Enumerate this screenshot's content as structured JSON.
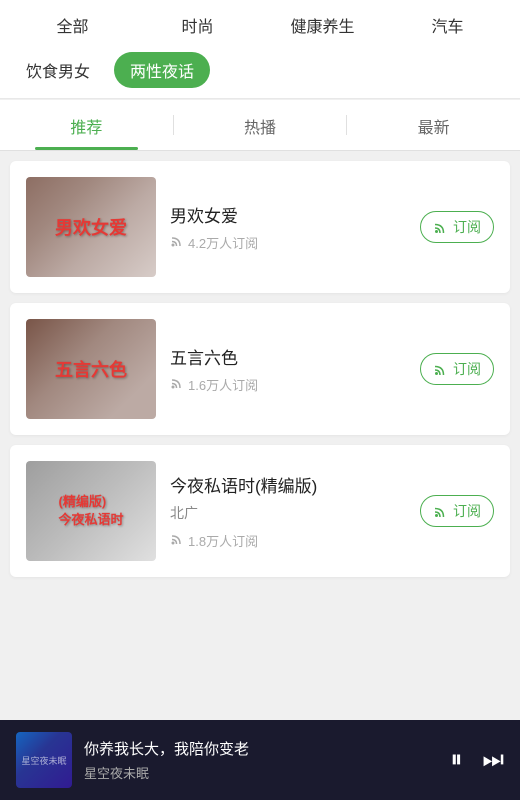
{
  "nav": {
    "row1": [
      {
        "label": "全部",
        "active": false
      },
      {
        "label": "时尚",
        "active": false
      },
      {
        "label": "健康养生",
        "active": false
      },
      {
        "label": "汽车",
        "active": false
      }
    ],
    "row2": [
      {
        "label": "饮食男女",
        "active": false
      },
      {
        "label": "两性夜话",
        "active": true
      }
    ]
  },
  "tabs": [
    {
      "label": "推荐",
      "active": true
    },
    {
      "label": "热播",
      "active": false
    },
    {
      "label": "最新",
      "active": false
    }
  ],
  "cards": [
    {
      "id": "card1",
      "title": "男欢女爱",
      "subtitle": "",
      "meta": "4.2万人订阅",
      "thumb_text": "男欢女爱",
      "thumb_class": "thumb-1",
      "subscribe_label": "订阅"
    },
    {
      "id": "card2",
      "title": "五言六色",
      "subtitle": "",
      "meta": "1.6万人订阅",
      "thumb_text": "五言六色",
      "thumb_class": "thumb-2",
      "subscribe_label": "订阅"
    },
    {
      "id": "card3",
      "title": "今夜私语时(精编版)",
      "subtitle": "北广",
      "meta": "1.8万人订阅",
      "thumb_text": "(精编版)\n今夜私语时",
      "thumb_class": "thumb-3",
      "subscribe_label": "订阅"
    }
  ],
  "player": {
    "title": "你养我长大，我陪你变老",
    "subtitle": "星空夜未眠",
    "thumb_text": "星空夜未眠",
    "pause_icon": "⏸",
    "next_icon": "⏭"
  }
}
